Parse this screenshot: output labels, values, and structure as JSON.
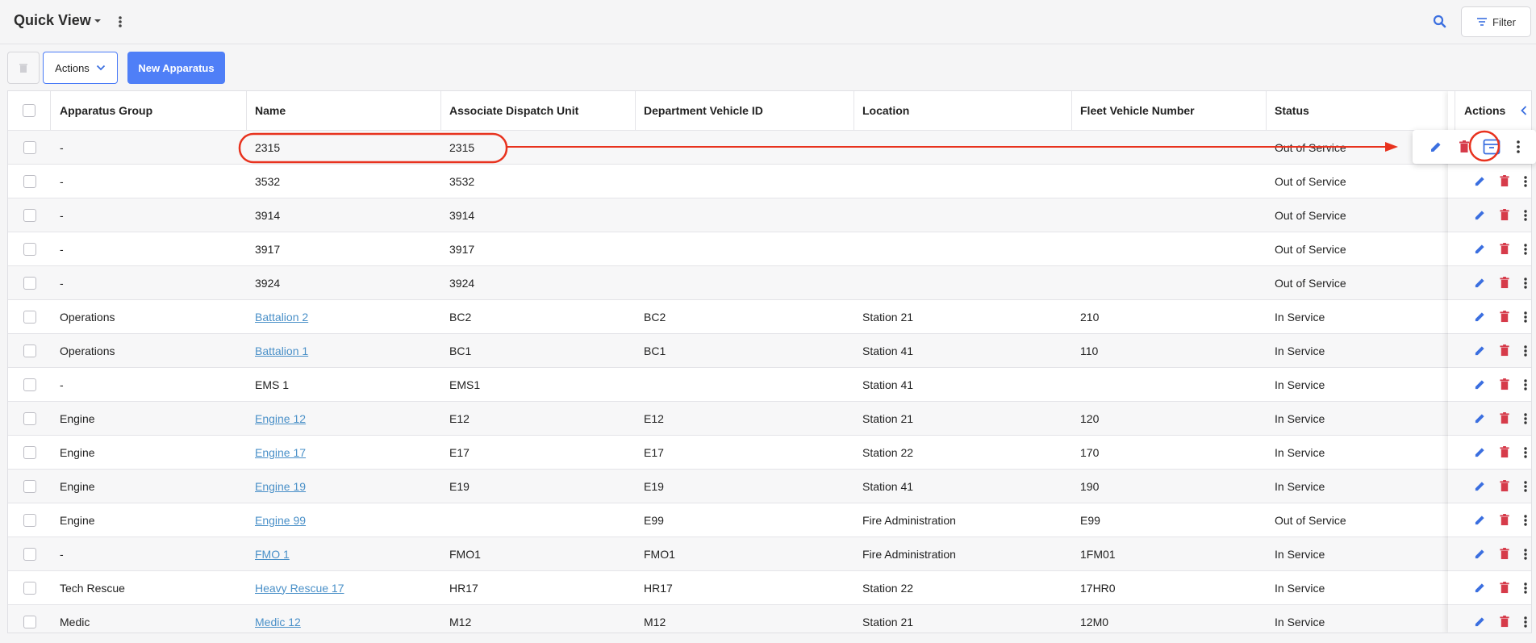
{
  "header": {
    "title": "Quick View",
    "filter_label": "Filter"
  },
  "toolbar": {
    "actions_label": "Actions",
    "new_label": "New Apparatus"
  },
  "columns": [
    "Apparatus Group",
    "Name",
    "Associate Dispatch Unit",
    "Department Vehicle ID",
    "Location",
    "Fleet Vehicle Number",
    "Status",
    "Actions"
  ],
  "rows": [
    {
      "group": "-",
      "name": "2315",
      "link": false,
      "adu": "2315",
      "dvid": "",
      "location": "",
      "fleet": "",
      "status": "Out of Service"
    },
    {
      "group": "-",
      "name": "3532",
      "link": false,
      "adu": "3532",
      "dvid": "",
      "location": "",
      "fleet": "",
      "status": "Out of Service"
    },
    {
      "group": "-",
      "name": "3914",
      "link": false,
      "adu": "3914",
      "dvid": "",
      "location": "",
      "fleet": "",
      "status": "Out of Service"
    },
    {
      "group": "-",
      "name": "3917",
      "link": false,
      "adu": "3917",
      "dvid": "",
      "location": "",
      "fleet": "",
      "status": "Out of Service"
    },
    {
      "group": "-",
      "name": "3924",
      "link": false,
      "adu": "3924",
      "dvid": "",
      "location": "",
      "fleet": "",
      "status": "Out of Service"
    },
    {
      "group": "Operations",
      "name": "Battalion 2",
      "link": true,
      "adu": "BC2",
      "dvid": "BC2",
      "location": "Station 21",
      "fleet": "210",
      "status": "In Service"
    },
    {
      "group": "Operations",
      "name": "Battalion 1",
      "link": true,
      "adu": "BC1",
      "dvid": "BC1",
      "location": "Station 41",
      "fleet": "110",
      "status": "In Service"
    },
    {
      "group": "-",
      "name": "EMS 1",
      "link": false,
      "adu": "EMS1",
      "dvid": "",
      "location": "Station 41",
      "fleet": "",
      "status": "In Service"
    },
    {
      "group": "Engine",
      "name": "Engine 12",
      "link": true,
      "adu": "E12",
      "dvid": "E12",
      "location": "Station 21",
      "fleet": "120",
      "status": "In Service"
    },
    {
      "group": "Engine",
      "name": "Engine 17",
      "link": true,
      "adu": "E17",
      "dvid": "E17",
      "location": "Station 22",
      "fleet": "170",
      "status": "In Service"
    },
    {
      "group": "Engine",
      "name": "Engine 19",
      "link": true,
      "adu": "E19",
      "dvid": "E19",
      "location": "Station 41",
      "fleet": "190",
      "status": "In Service"
    },
    {
      "group": "Engine",
      "name": "Engine 99",
      "link": true,
      "adu": "",
      "dvid": "E99",
      "location": "Fire Administration",
      "fleet": "E99",
      "status": "Out of Service"
    },
    {
      "group": "-",
      "name": "FMO 1",
      "link": true,
      "adu": "FMO1",
      "dvid": "FMO1",
      "location": "Fire Administration",
      "fleet": "1FM01",
      "status": "In Service"
    },
    {
      "group": "Tech Rescue",
      "name": "Heavy Rescue 17",
      "link": true,
      "adu": "HR17",
      "dvid": "HR17",
      "location": "Station 22",
      "fleet": "17HR0",
      "status": "In Service"
    },
    {
      "group": "Medic",
      "name": "Medic 12",
      "link": true,
      "adu": "M12",
      "dvid": "M12",
      "location": "Station 21",
      "fleet": "12M0",
      "status": "In Service"
    }
  ],
  "colors": {
    "accent": "#4f7ff7",
    "link": "#4a90c8",
    "edit": "#3b6fe0",
    "delete": "#d63b4a",
    "annotation": "#e8321e"
  },
  "icons": [
    "caret-down-icon",
    "kebab-icon",
    "search-icon",
    "filter-icon",
    "chevron-down-icon",
    "chevron-left-icon",
    "edit-icon",
    "trash-icon",
    "archive-icon"
  ]
}
